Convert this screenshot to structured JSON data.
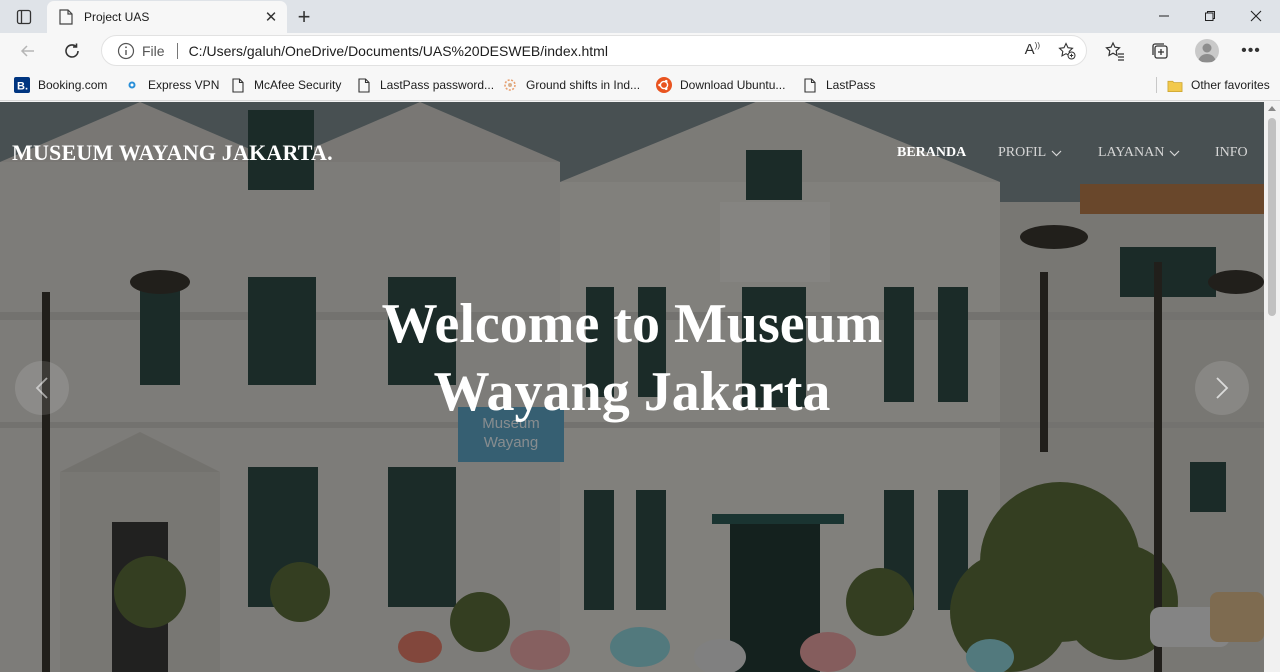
{
  "browser": {
    "tab_title": "Project UAS",
    "address_scheme": "File",
    "url": "C:/Users/galuh/OneDrive/Documents/UAS%20DESWEB/index.html",
    "bookmarks": [
      {
        "label": "Booking.com",
        "icon": "booking-icon"
      },
      {
        "label": "Express VPN",
        "icon": "expressvpn-icon"
      },
      {
        "label": "McAfee Security",
        "icon": "page-icon"
      },
      {
        "label": "LastPass password...",
        "icon": "page-icon"
      },
      {
        "label": "Ground shifts in Ind...",
        "icon": "news-icon"
      },
      {
        "label": "Download Ubuntu...",
        "icon": "ubuntu-icon"
      },
      {
        "label": "LastPass",
        "icon": "page-icon"
      }
    ],
    "other_favorites": "Other favorites"
  },
  "site": {
    "brand": "MUSEUM WAYANG JAKARTA.",
    "nav": [
      {
        "label": "BERANDA",
        "active": true
      },
      {
        "label": "PROFIL",
        "dropdown": true
      },
      {
        "label": "LAYANAN",
        "dropdown": true
      },
      {
        "label": "INFO"
      }
    ],
    "hero_title_line1": "Welcome to Museum",
    "hero_title_line2": "Wayang Jakarta",
    "sign_text_line1": "Museum",
    "sign_text_line2": "Wayang"
  },
  "colors": {
    "booking": "#003580",
    "ubuntu": "#e95420",
    "folder": "#f2c94c"
  }
}
